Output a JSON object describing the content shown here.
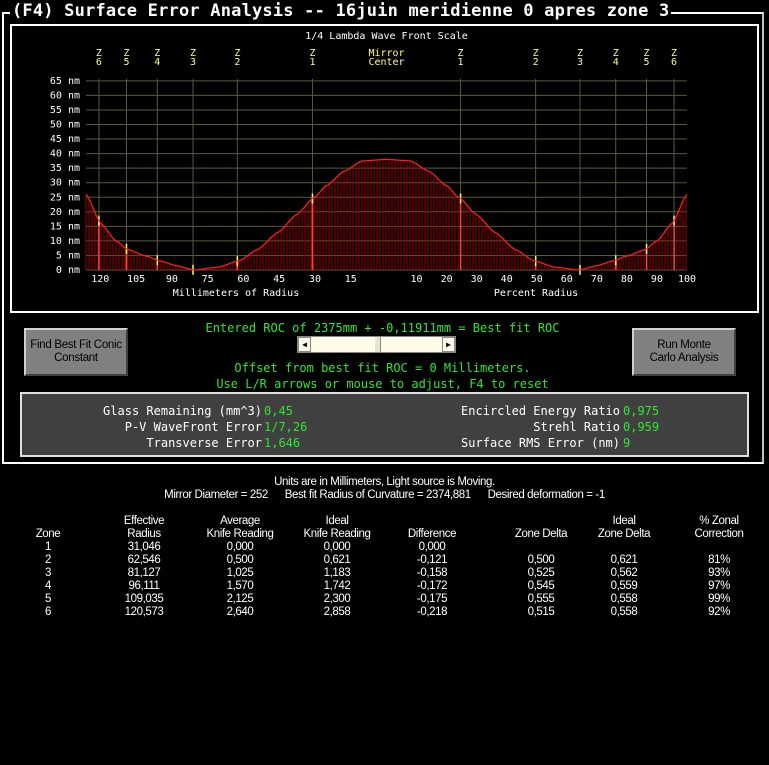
{
  "window": {
    "title": "(F4)  Surface Error Analysis -- 16juin meridienne 0 apres zone 3"
  },
  "chart_data": {
    "type": "area",
    "title": "1/4 Lambda Wave Front Scale",
    "xlabel_left": "Millimeters of Radius",
    "xlabel_right": "Percent Radius",
    "yticks": [
      "0 nm",
      "5 nm",
      "10 nm",
      "15 nm",
      "20 nm",
      "25 nm",
      "30 nm",
      "35 nm",
      "40 nm",
      "45 nm",
      "50 nm",
      "55 nm",
      "60 nm",
      "65 nm"
    ],
    "ylim": [
      0,
      65
    ],
    "x_mm_ticks": [
      "120",
      "105",
      "90",
      "75",
      "60",
      "45",
      "30",
      "15"
    ],
    "x_mm_values": [
      120,
      105,
      90,
      75,
      60,
      45,
      30,
      15
    ],
    "x_pct_ticks": [
      "10",
      "20",
      "30",
      "40",
      "50",
      "60",
      "70",
      "80",
      "90",
      "100"
    ],
    "x_pct_values": [
      10,
      20,
      30,
      40,
      50,
      60,
      70,
      80,
      90,
      100
    ],
    "center_label": [
      "Mirror",
      "Center"
    ],
    "zones": [
      {
        "label": [
          "Z",
          "1"
        ],
        "radius_mm": 31.046
      },
      {
        "label": [
          "Z",
          "2"
        ],
        "radius_mm": 62.546
      },
      {
        "label": [
          "Z",
          "3"
        ],
        "radius_mm": 81.127
      },
      {
        "label": [
          "Z",
          "4"
        ],
        "radius_mm": 96.111
      },
      {
        "label": [
          "Z",
          "5"
        ],
        "radius_mm": 109.035
      },
      {
        "label": [
          "Z",
          "6"
        ],
        "radius_mm": 120.573
      }
    ],
    "mirror_radius_mm": 126,
    "profile": {
      "percent_radius": [
        0,
        8,
        14,
        20,
        24,
        30,
        36,
        43,
        49,
        56,
        64,
        70,
        75,
        80,
        86,
        90,
        95,
        100
      ],
      "nm": [
        38,
        37.5,
        34,
        29,
        25,
        19,
        13,
        7,
        3.2,
        1,
        0,
        1.5,
        3,
        4.8,
        7,
        10,
        16,
        26
      ]
    },
    "grid": true,
    "colors": {
      "curve": "#ff2020",
      "fill": "#a00000",
      "grid": "#5a5a3c",
      "zone_label": "#ffff80",
      "zone_mark": "#ffff60"
    }
  },
  "controls": {
    "roc_text": "Entered ROC of 2375mm + -0,11911mm = Best fit ROC",
    "slider_position_fraction": 0.5,
    "offset_text": "Offset from best fit ROC = 0 Millimeters.",
    "hint_text": "Use L/R arrows or mouse to adjust, F4 to reset",
    "find_conic_button": "Find Best Fit Conic Constant",
    "monte_carlo_button": "Run Monte Carlo Analysis"
  },
  "stats": {
    "glass_label": "Glass Remaining (mm^3)",
    "glass_value": "0,45",
    "pv_label": "P-V WaveFront Error",
    "pv_value": "1/7,26",
    "transverse_label": "Transverse Error",
    "transverse_value": "1,646",
    "energy_label": "Encircled Energy Ratio",
    "energy_value": "0,975",
    "strehl_label": "Strehl Ratio",
    "strehl_value": "0,959",
    "rms_label": "Surface RMS Error (nm)",
    "rms_value": "9"
  },
  "summary": {
    "line1": "Units are in Millimeters, Light source is Moving.",
    "diameter": "Mirror Diameter = 252",
    "best_fit": "Best fit Radius of Curvature = 2374,881",
    "deformation": "Desired deformation = -1"
  },
  "table": {
    "headers": [
      [
        "",
        "Zone"
      ],
      [
        "Effective",
        "Radius"
      ],
      [
        "Average",
        "Knife Reading"
      ],
      [
        "Ideal",
        "Knife Reading"
      ],
      [
        "",
        "Difference"
      ],
      [
        "",
        "Zone Delta"
      ],
      [
        "Ideal",
        "Zone Delta"
      ],
      [
        "% Zonal",
        "Correction"
      ]
    ],
    "rows": [
      [
        "1",
        "31,046",
        "0,000",
        "0,000",
        "0,000",
        "",
        "",
        ""
      ],
      [
        "2",
        "62,546",
        "0,500",
        "0,621",
        "-0,121",
        "0,500",
        "0,621",
        "81%"
      ],
      [
        "3",
        "81,127",
        "1,025",
        "1,183",
        "-0,158",
        "0,525",
        "0,562",
        "93%"
      ],
      [
        "4",
        "96,111",
        "1,570",
        "1,742",
        "-0,172",
        "0,545",
        "0,559",
        "97%"
      ],
      [
        "5",
        "109,035",
        "2,125",
        "2,300",
        "-0,175",
        "0,555",
        "0,558",
        "99%"
      ],
      [
        "6",
        "120,573",
        "2,640",
        "2,858",
        "-0,218",
        "0,515",
        "0,558",
        "92%"
      ]
    ]
  }
}
